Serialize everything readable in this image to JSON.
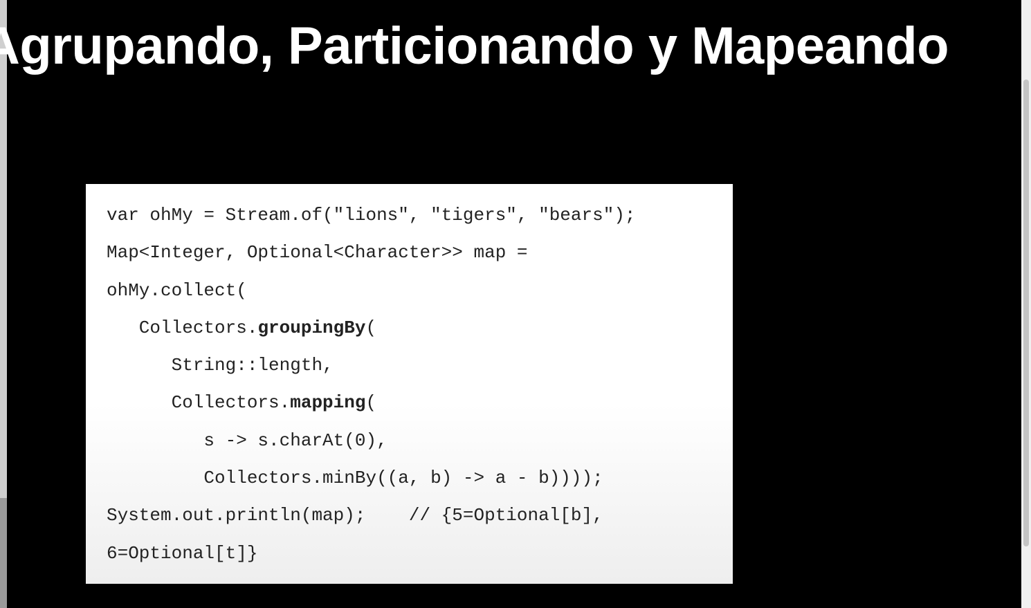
{
  "slide": {
    "title": "Agrupando, Particionando y Mapeando",
    "code": {
      "line1": "var ohMy = Stream.of(\"lions\", \"tigers\", \"bears\");",
      "line2": "Map<Integer, Optional<Character>> map =",
      "line3": "ohMy.collect(",
      "line4_pre": "   Collectors.",
      "line4_bold": "groupingBy",
      "line4_post": "(",
      "line5": "      String::length,",
      "line6_pre": "      Collectors.",
      "line6_bold": "mapping",
      "line6_post": "(",
      "line7": "         s -> s.charAt(0),",
      "line8": "         Collectors.minBy((a, b) -> a - b))));",
      "line9": "System.out.println(map);    // {5=Optional[b],",
      "line10": "6=Optional[t]}"
    }
  },
  "colors": {
    "background": "#000000",
    "title_text": "#ffffff",
    "code_bg": "#ffffff",
    "code_text": "#222222"
  }
}
